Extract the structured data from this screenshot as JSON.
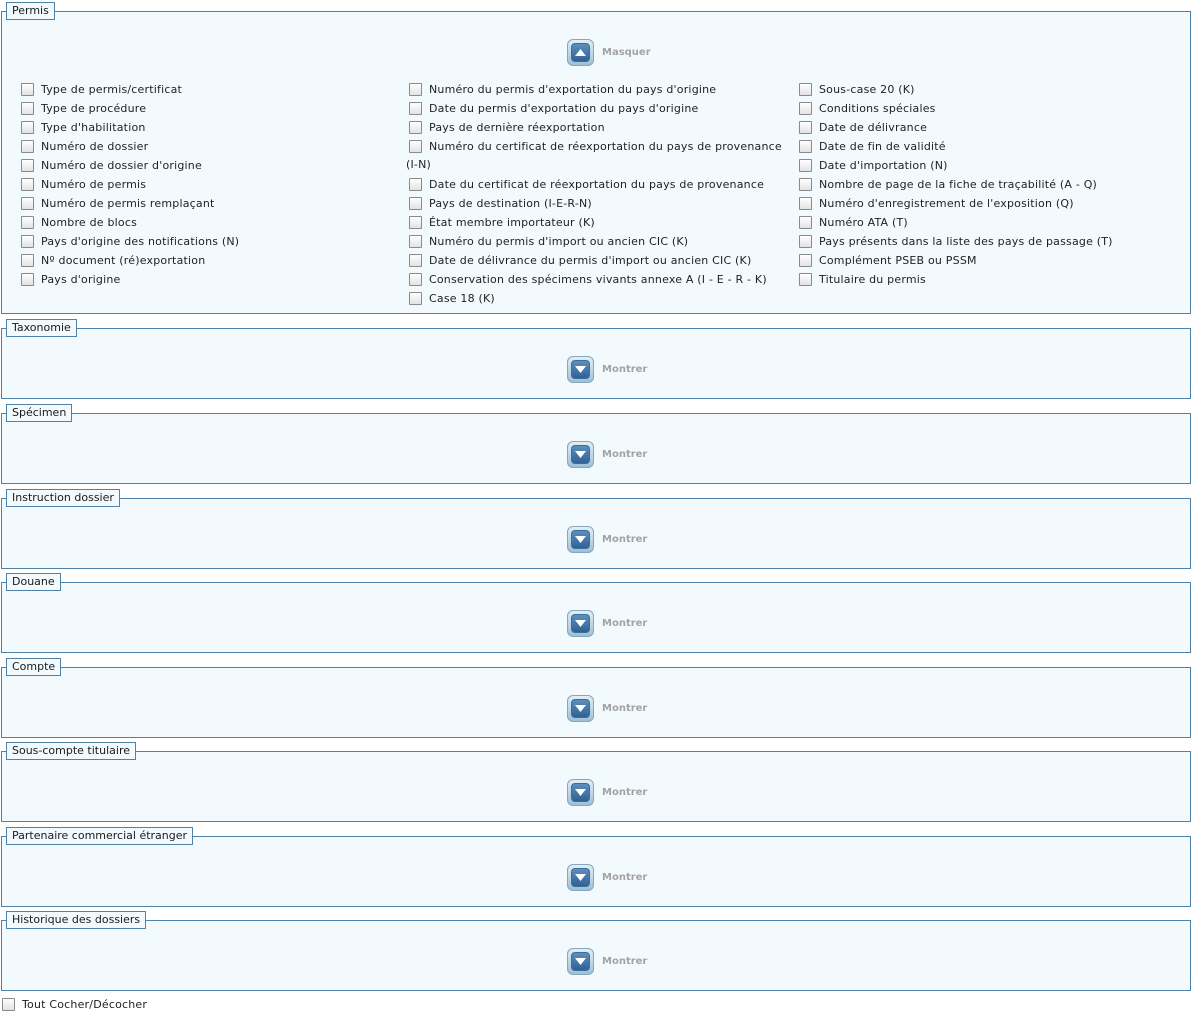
{
  "sections": {
    "permis": {
      "title": "Permis",
      "toggle_label": "Masquer",
      "col1": [
        "Type de permis/certificat",
        "Type de procédure",
        "Type d'habilitation",
        "Numéro de dossier",
        "Numéro de dossier d'origine",
        "Numéro de permis",
        "Numéro de permis remplaçant",
        "Nombre de blocs",
        "Pays d'origine des notifications (N)",
        "Nº document (ré)exportation",
        "Pays d'origine"
      ],
      "col2": [
        "Numéro du permis d'exportation du pays d'origine",
        "Date du permis d'exportation du pays d'origine",
        "Pays de dernière réexportation",
        "Numéro du certificat de réexportation du pays de provenance",
        "Date du certificat de réexportation du pays de provenance",
        "Pays de destination (I-E-R-N)",
        "État membre importateur (K)",
        "Numéro du permis d'import ou ancien CIC (K)",
        "Date de délivrance du permis d'import ou ancien CIC (K)",
        "Conservation des spécimens vivants annexe A (I - E - R - K)",
        "Case 18 (K)"
      ],
      "col2_wrap": "(I-N)",
      "col3": [
        "Sous-case 20 (K)",
        "Conditions spéciales",
        "Date de délivrance",
        "Date de fin de validité",
        "Date d'importation (N)",
        "Nombre de page de la fiche de traçabilité (A - Q)",
        "Numéro d'enregistrement de l'exposition (Q)",
        "Numéro ATA (T)",
        "Pays présents dans la liste des pays de passage (T)",
        "Complément PSEB ou PSSM",
        "Titulaire du permis"
      ]
    },
    "collapsed": [
      {
        "title": "Taxonomie",
        "toggle_label": "Montrer"
      },
      {
        "title": "Spécimen",
        "toggle_label": "Montrer"
      },
      {
        "title": "Instruction dossier",
        "toggle_label": "Montrer"
      },
      {
        "title": "Douane",
        "toggle_label": "Montrer"
      },
      {
        "title": "Compte",
        "toggle_label": "Montrer"
      },
      {
        "title": "Sous-compte titulaire",
        "toggle_label": "Montrer"
      },
      {
        "title": "Partenaire commercial étranger",
        "toggle_label": "Montrer"
      },
      {
        "title": "Historique des dossiers",
        "toggle_label": "Montrer"
      }
    ]
  },
  "footer": {
    "toggle_all_label": "Tout Cocher/Décocher"
  },
  "icons": {
    "collapse": "chevron-up-icon",
    "expand": "chevron-down-icon"
  },
  "colors": {
    "border": "#4f82a8",
    "panel_bg": "#f3fafd",
    "button": "#2f6294"
  }
}
